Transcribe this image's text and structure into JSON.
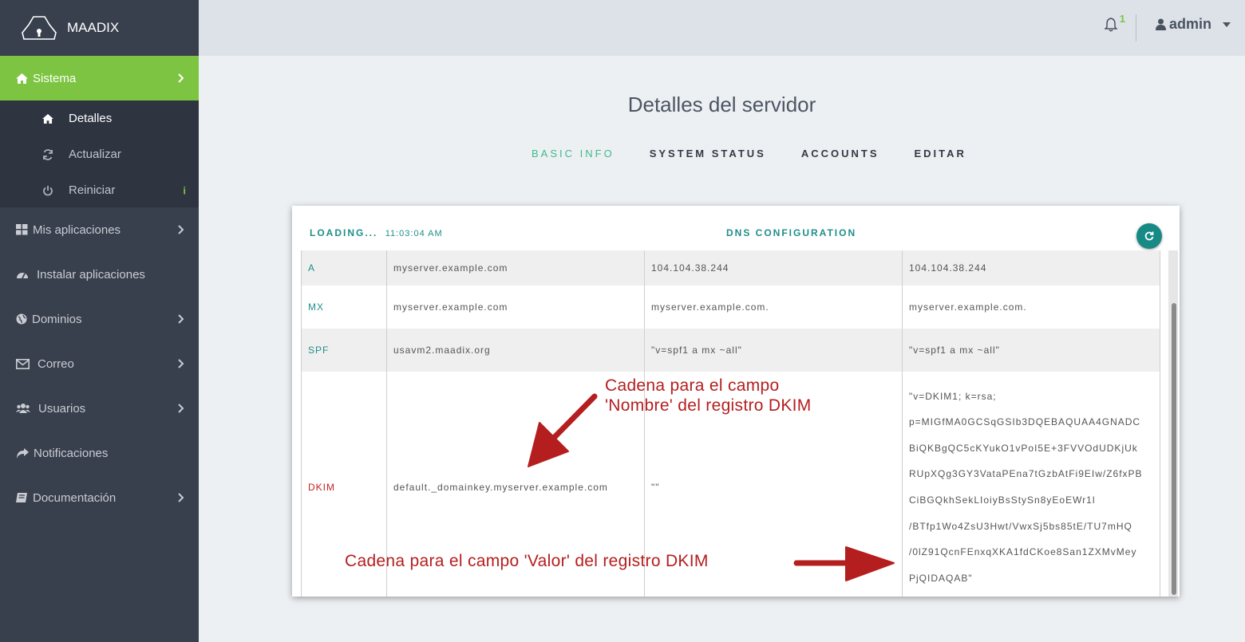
{
  "brand": {
    "name": "MAADIX"
  },
  "sidebar": {
    "active": {
      "label": "Sistema"
    },
    "submenu": [
      {
        "label": "Detalles"
      },
      {
        "label": "Actualizar"
      },
      {
        "label": "Reiniciar",
        "badge": "i"
      }
    ],
    "items": [
      {
        "label": "Mis aplicaciones"
      },
      {
        "label": "Instalar aplicaciones"
      },
      {
        "label": "Dominios"
      },
      {
        "label": "Correo"
      },
      {
        "label": "Usuarios"
      },
      {
        "label": "Notificaciones"
      },
      {
        "label": "Documentación"
      }
    ]
  },
  "topbar": {
    "notification_count": "1",
    "username": "admin"
  },
  "main": {
    "title": "Detalles del servidor",
    "tabs": [
      {
        "label": "BASIC INFO",
        "active": true
      },
      {
        "label": "SYSTEM STATUS"
      },
      {
        "label": "ACCOUNTS"
      },
      {
        "label": "EDITAR"
      }
    ]
  },
  "card": {
    "loading": "LOADING...",
    "time": "11:03:04 AM",
    "title": "DNS CONFIGURATION",
    "rows": [
      {
        "type": "A",
        "name": "myserver.example.com",
        "current": "104.104.38.244",
        "expected": "104.104.38.244"
      },
      {
        "type": "MX",
        "name": "myserver.example.com",
        "current": "myserver.example.com.",
        "expected": "myserver.example.com."
      },
      {
        "type": "SPF",
        "name": "usavm2.maadix.org",
        "current": "\"v=spf1 a mx ~all\"",
        "expected": "\"v=spf1 a mx ~all\""
      },
      {
        "type": "DKIM",
        "name": "default._domainkey.myserver.example.com",
        "current": "\"\"",
        "expected_lines": [
          "\"v=DKIM1; k=rsa;",
          "p=MIGfMA0GCSqGSIb3DQEBAQUAA4GNADC",
          "BiQKBgQC5cKYukO1vPoI5E+3FVVOdUDKjUk",
          "RUpXQg3GY3VataPEna7tGzbAtFi9EIw/Z6fxPB",
          "CiBGQkhSekLIoiyBsStySn8yEoEWr1l",
          "/BTfp1Wo4ZsU3Hwt/VwxSj5bs85tE/TU7mHQ",
          "/0lZ91QcnFEnxqXKA1fdCKoe8San1ZXMvMey",
          "PjQIDAQAB\""
        ]
      }
    ]
  },
  "annotations": {
    "name_line1": "Cadena para el campo",
    "name_line2": "'Nombre' del registro DKIM",
    "value": "Cadena para el campo 'Valor' del registro  DKIM"
  }
}
